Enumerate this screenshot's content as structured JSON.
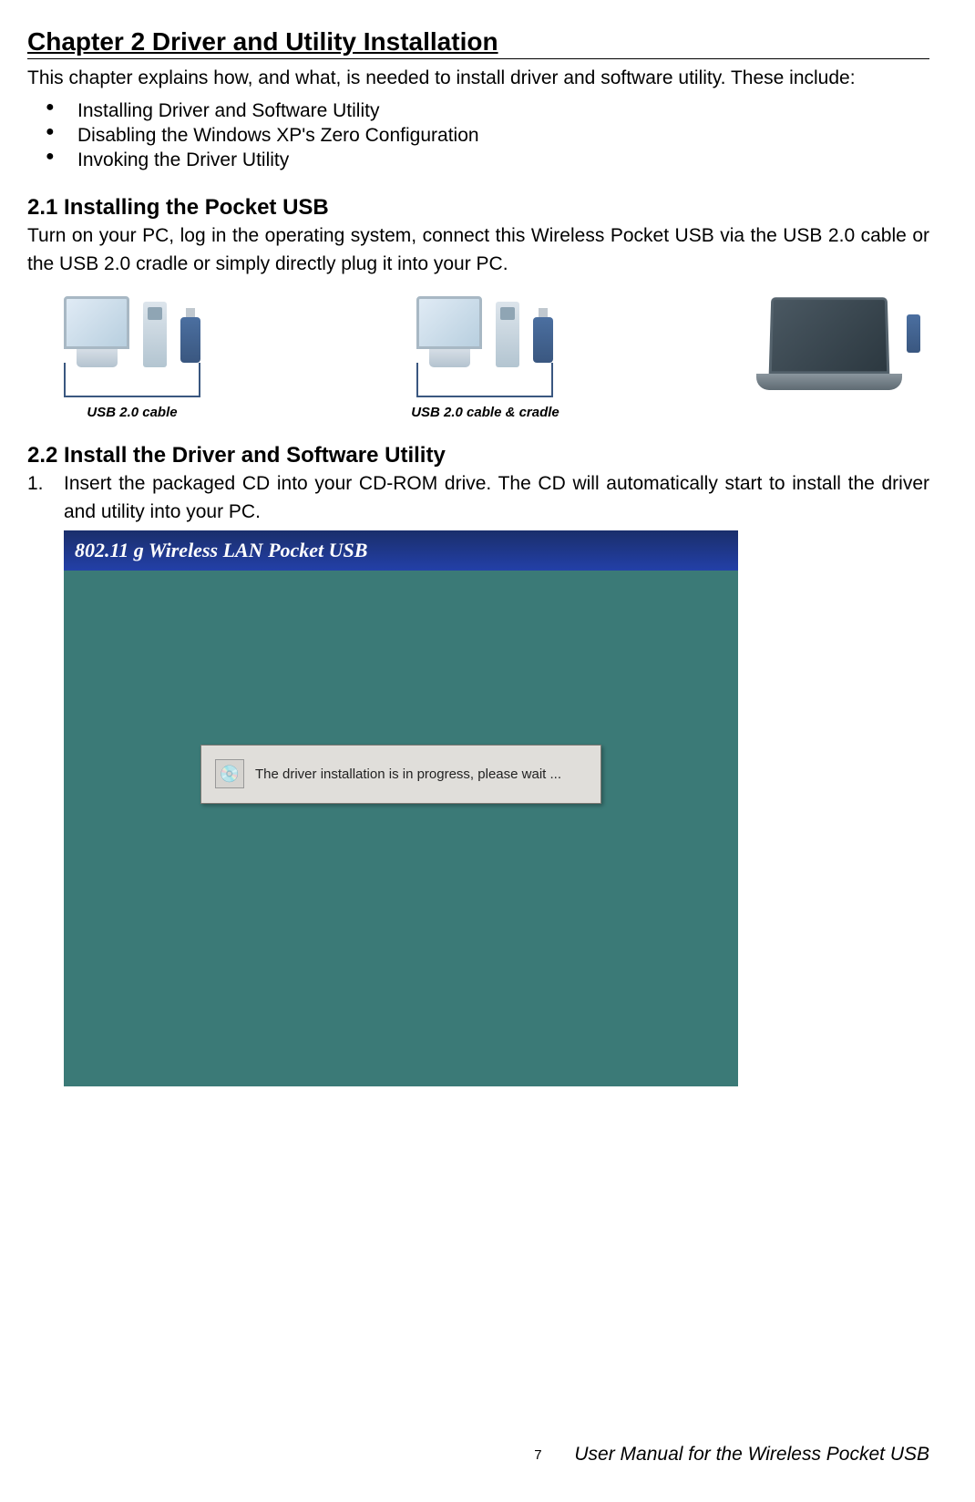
{
  "chapter": {
    "title": "Chapter 2    Driver and Utility Installation",
    "intro": "This chapter explains how, and what, is needed to install driver and software utility. These include:",
    "bullets": [
      "Installing Driver and Software Utility",
      "Disabling the Windows XP's Zero Configuration",
      "Invoking the Driver Utility"
    ]
  },
  "section21": {
    "heading": "2.1 Installing the Pocket USB",
    "text": "Turn on your PC, log in the operating system, connect this Wireless Pocket USB via the USB 2.0 cable or the USB 2.0 cradle or simply directly plug it into your PC.",
    "captions": {
      "left": "USB 2.0 cable",
      "middle": "USB 2.0 cable & cradle"
    }
  },
  "section22": {
    "heading": "2.2 Install the Driver and Software Utility",
    "step1_num": "1.",
    "step1_text": "Insert the packaged CD into your CD-ROM drive. The CD will automatically start to install the driver and utility into your PC."
  },
  "installer": {
    "title": "802.11 g Wireless LAN Pocket USB",
    "dialog_text": "The driver installation is in progress, please wait ...",
    "icon_name": "setup-icon"
  },
  "footer": {
    "page_number": "7",
    "manual_title": "User Manual for the Wireless Pocket USB"
  }
}
